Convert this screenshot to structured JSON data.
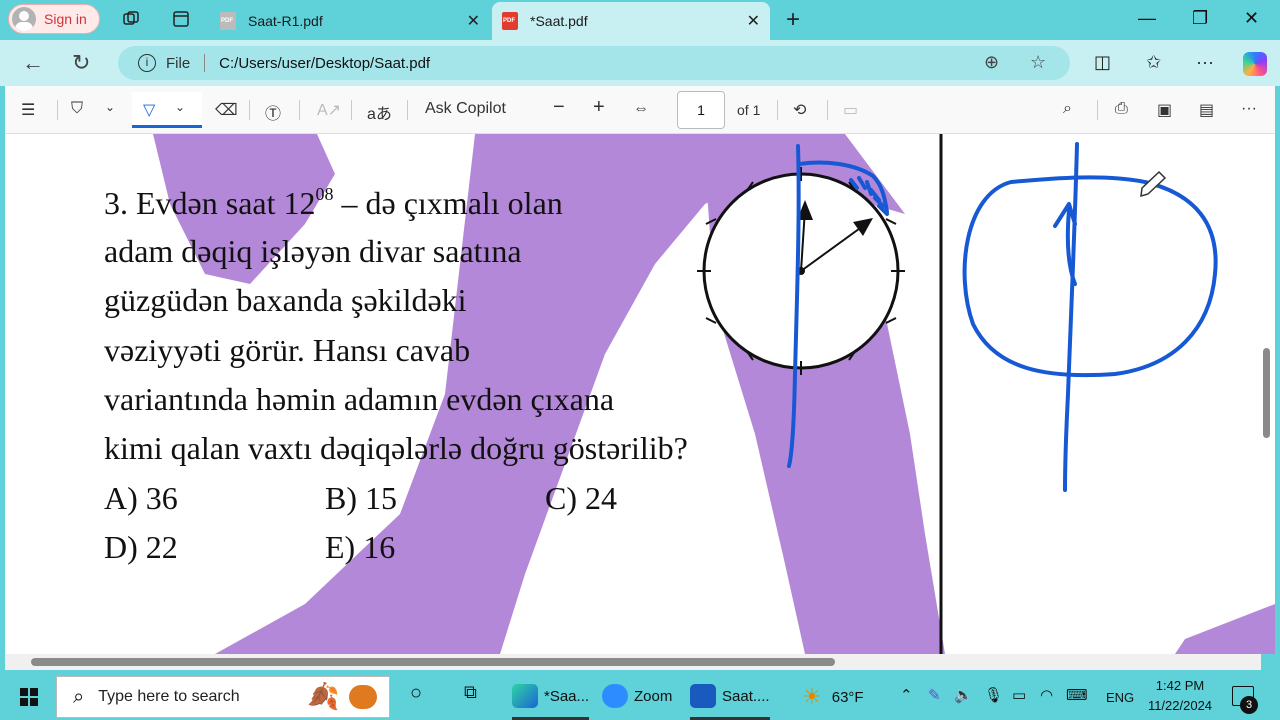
{
  "browser": {
    "signin_label": "Sign in",
    "tabs": [
      {
        "title": "Saat-R1.pdf"
      },
      {
        "title": "*Saat.pdf"
      }
    ],
    "address": {
      "scheme_label": "File",
      "url": "C:/Users/user/Desktop/Saat.pdf"
    }
  },
  "pdf_toolbar": {
    "ask_copilot": "Ask Copilot",
    "read_aloud_glyph": "aあ",
    "page_current": "1",
    "page_total": "of 1"
  },
  "document": {
    "question_lines": [
      "3. Evdən saat 12",
      "adam dəqiq işləyən divar saatına",
      "güzgüdən baxanda şəkildəki",
      "vəziyyəti görür. Hansı cavab",
      "variantında həmin adamın evdən çıxana",
      "kimi qalan vaxtı dəqiqələrlə doğru göstərilib?"
    ],
    "time_superscript": "08",
    "line1_rest": " – də çıxmalı olan",
    "options": [
      {
        "label": "A)",
        "value": "36"
      },
      {
        "label": "B)",
        "value": "15"
      },
      {
        "label": "C)",
        "value": "24"
      },
      {
        "label": "D)",
        "value": "22"
      },
      {
        "label": "E)",
        "value": "16"
      }
    ]
  },
  "taskbar": {
    "search_placeholder": "Type here to search",
    "apps": [
      {
        "label": "*Saa..."
      },
      {
        "label": "Zoom"
      },
      {
        "label": "Saat...."
      }
    ],
    "weather": "63°F",
    "language": "ENG",
    "time": "1:42 PM",
    "date": "11/22/2024",
    "notifications": "3"
  },
  "colors": {
    "chrome_teal": "#5ed1d9",
    "address_light": "#c8f0f3",
    "watermark_purple": "#b388d8",
    "ink_blue": "#1759d4"
  }
}
